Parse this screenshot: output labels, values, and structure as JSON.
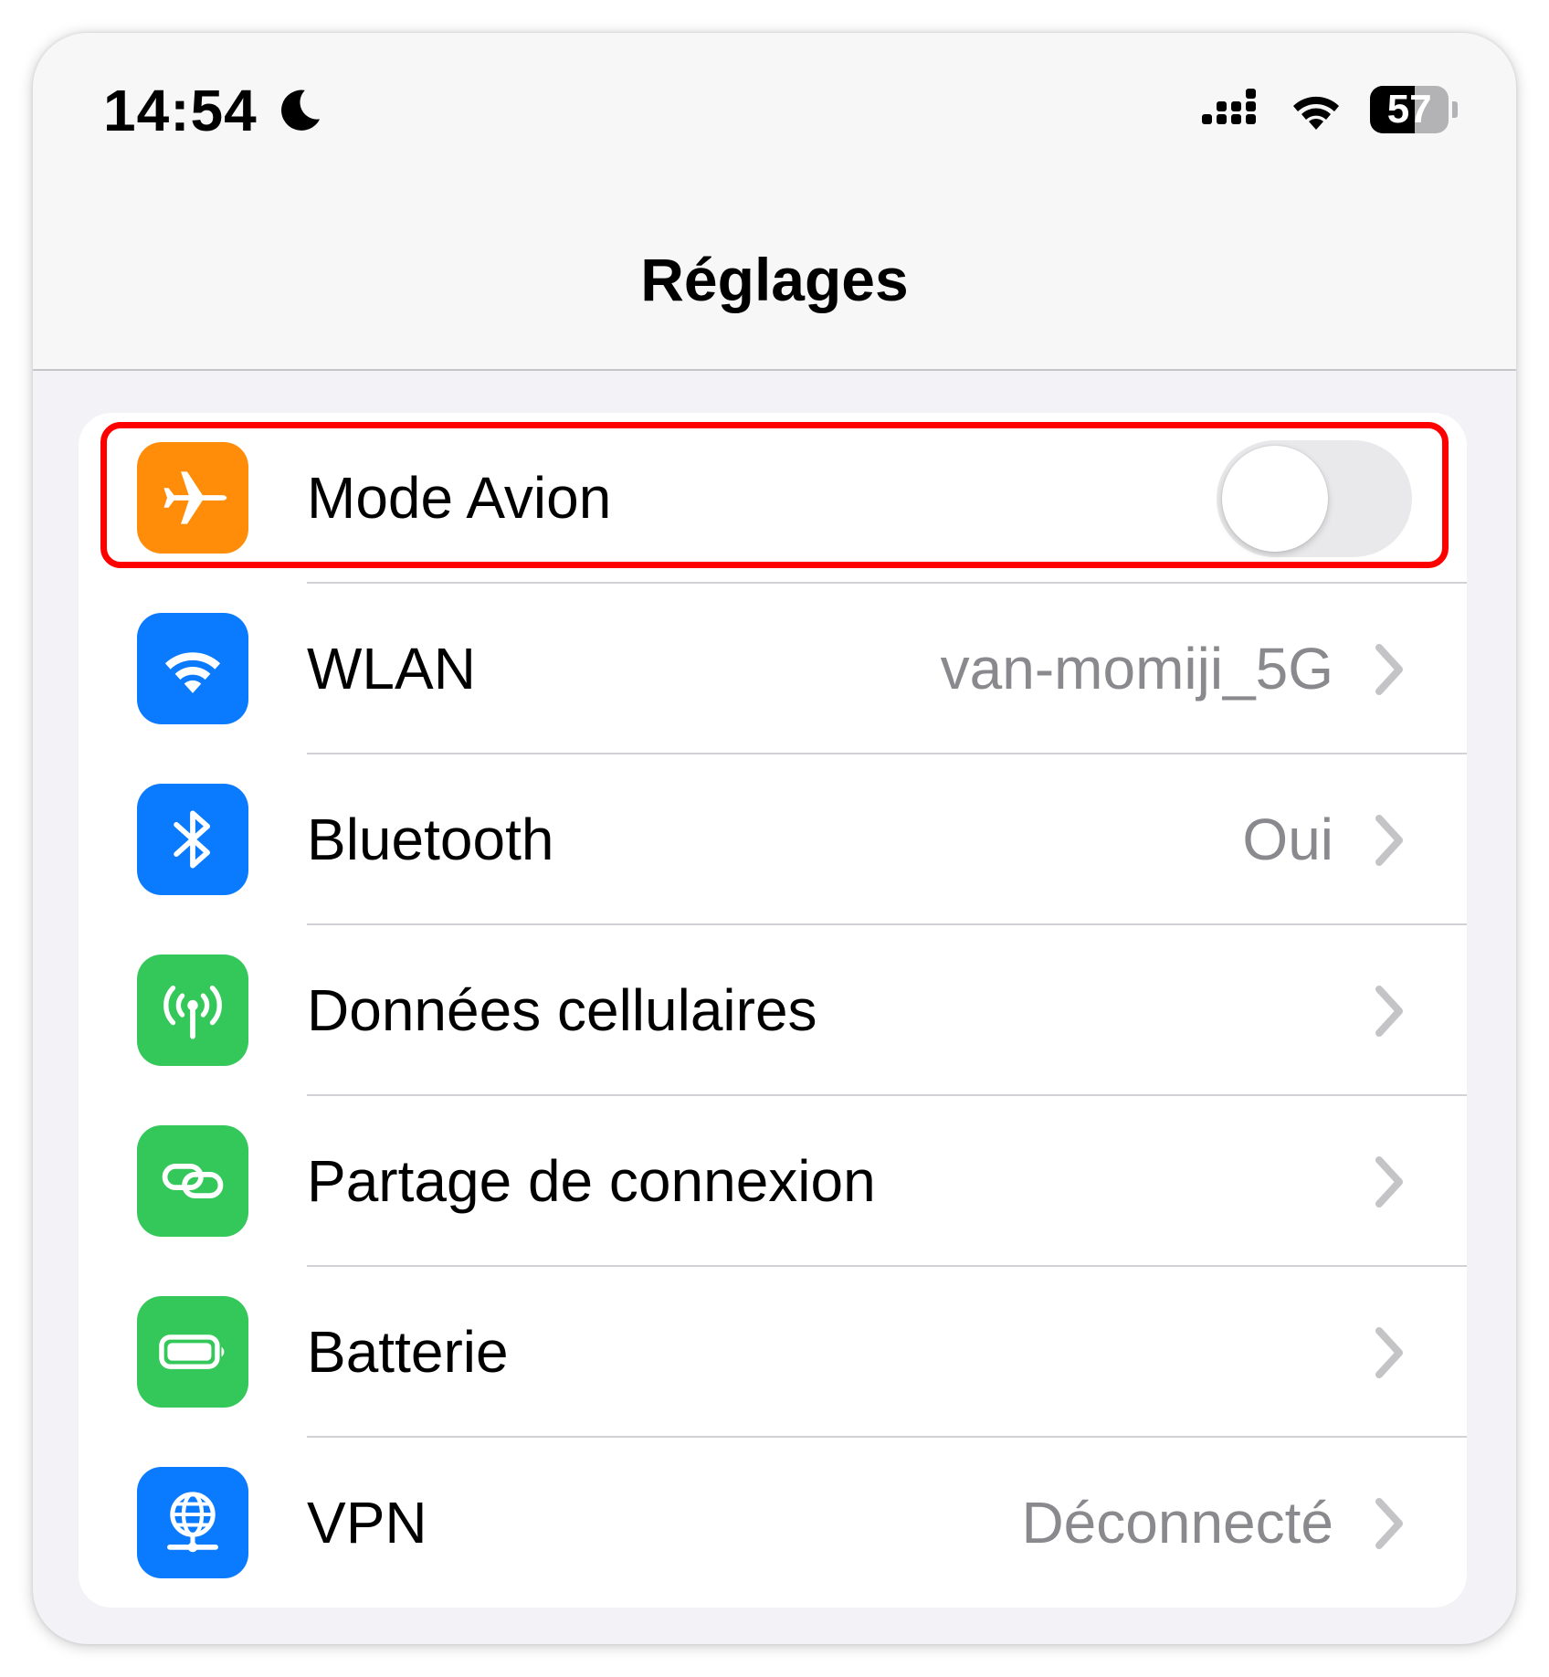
{
  "status_bar": {
    "time": "14:54",
    "moon_icon": "moon-icon",
    "signal_icon": "cellular-signal-icon",
    "wifi_icon": "wifi-icon",
    "battery_level": "57",
    "battery_fraction": 0.57
  },
  "header": {
    "title": "Réglages"
  },
  "settings": [
    {
      "id": "airplane",
      "label": "Mode Avion",
      "icon": "airplane-icon",
      "icon_color": "#ff8d0a",
      "toggle_on": false
    },
    {
      "id": "wlan",
      "label": "WLAN",
      "value": "van-momiji_5G",
      "icon": "wifi-icon",
      "icon_color": "#0a7aff"
    },
    {
      "id": "bluetooth",
      "label": "Bluetooth",
      "value": "Oui",
      "icon": "bluetooth-icon",
      "icon_color": "#0a7aff"
    },
    {
      "id": "cellular",
      "label": "Données cellulaires",
      "value": "",
      "icon": "cellular-antenna-icon",
      "icon_color": "#34c759"
    },
    {
      "id": "hotspot",
      "label": "Partage de connexion",
      "value": "",
      "icon": "link-icon",
      "icon_color": "#34c759"
    },
    {
      "id": "battery",
      "label": "Batterie",
      "value": "",
      "icon": "battery-icon",
      "icon_color": "#34c759"
    },
    {
      "id": "vpn",
      "label": "VPN",
      "value": "Déconnecté",
      "icon": "globe-network-icon",
      "icon_color": "#0a7aff"
    }
  ],
  "highlight_color": "#ff0000"
}
